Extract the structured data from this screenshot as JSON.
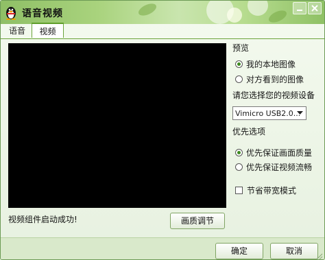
{
  "window": {
    "title": "语音视频"
  },
  "tabs": [
    {
      "label": "语音",
      "active": false
    },
    {
      "label": "视频",
      "active": true
    }
  ],
  "preview": {
    "heading": "预览",
    "options": [
      {
        "label": "我的本地图像",
        "selected": true
      },
      {
        "label": "对方看到的图像",
        "selected": false
      }
    ]
  },
  "device": {
    "prompt": "请您选择您的视频设备",
    "selected_value": "Vimicro USB2.0..."
  },
  "priority": {
    "heading": "优先选项",
    "options": [
      {
        "label": "优先保证画面质量",
        "selected": true
      },
      {
        "label": "优先保证视频流畅",
        "selected": false
      }
    ]
  },
  "bandwidth": {
    "label": "节省带宽模式",
    "checked": false
  },
  "status": {
    "text": "视频组件启动成功!"
  },
  "buttons": {
    "quality": "画质调节",
    "ok": "确定",
    "cancel": "取消"
  },
  "colors": {
    "accent_green": "#5f9e2a",
    "preview_bg": "#000000"
  },
  "icons": {
    "app": "qq-penguin-icon",
    "minimize": "minimize-icon",
    "close": "close-icon",
    "dropdown": "chevron-down-icon"
  }
}
